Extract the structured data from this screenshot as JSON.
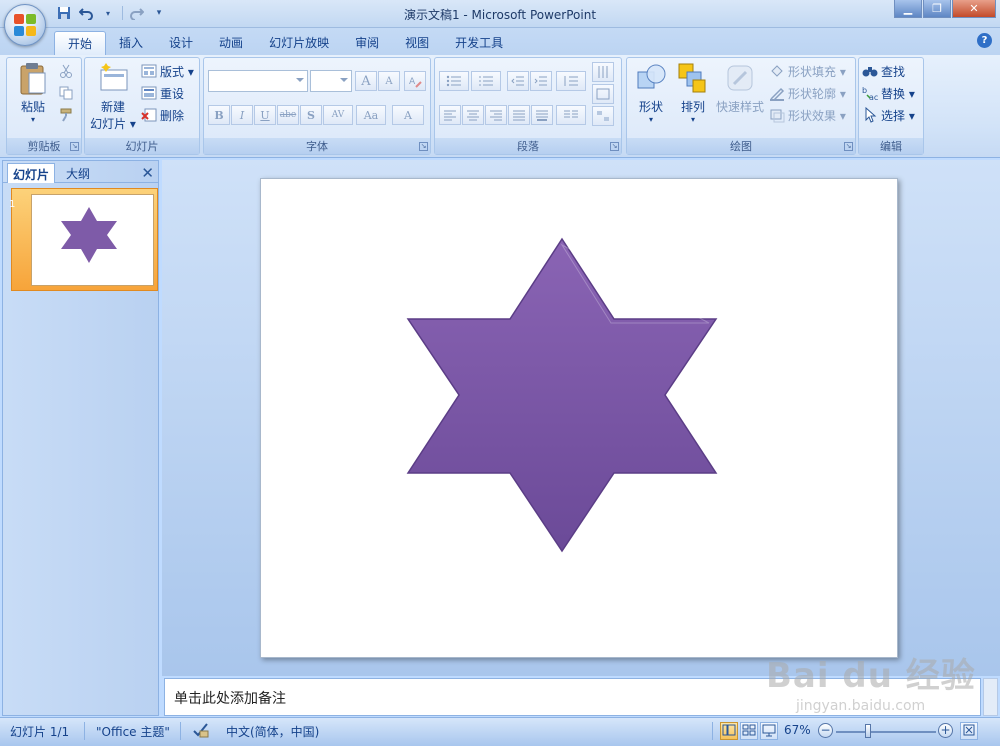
{
  "window": {
    "title": "演示文稿1 - Microsoft PowerPoint",
    "minimize": "▁",
    "maximize": "❐",
    "close": "✕"
  },
  "qat": {
    "save_icon": "save-icon",
    "undo_icon": "undo-icon",
    "redo_icon": "redo-icon",
    "customize_icon": "dropdown-icon"
  },
  "tabs": [
    {
      "label": "开始",
      "active": true
    },
    {
      "label": "插入"
    },
    {
      "label": "设计"
    },
    {
      "label": "动画"
    },
    {
      "label": "幻灯片放映"
    },
    {
      "label": "审阅"
    },
    {
      "label": "视图"
    },
    {
      "label": "开发工具"
    }
  ],
  "help": "?",
  "ribbon": {
    "clipboard": {
      "label": "剪贴板",
      "paste": "粘贴"
    },
    "slides": {
      "label": "幻灯片",
      "new_slide_1": "新建",
      "new_slide_2": "幻灯片 ▾",
      "layout": "版式 ▾",
      "reset": "重设",
      "delete": "删除"
    },
    "font": {
      "label": "字体",
      "bold": "B",
      "italic": "I",
      "underline": "U",
      "strike": "abe",
      "shadow": "S",
      "spacing": "AV",
      "case": "Aa",
      "color": "A",
      "grow": "A",
      "shrink": "A"
    },
    "paragraph": {
      "label": "段落"
    },
    "drawing": {
      "label": "绘图",
      "shapes": "形状",
      "arrange": "排列",
      "quick_styles": "快速样式",
      "fill": "形状填充 ▾",
      "outline": "形状轮廓 ▾",
      "effects": "形状效果 ▾"
    },
    "editing": {
      "label": "编辑",
      "find": "查找",
      "replace": "替换 ▾",
      "select": "选择 ▾"
    }
  },
  "left_panel": {
    "tab_slides": "幻灯片",
    "tab_outline": "大纲",
    "close": "✕",
    "slide_number": "1"
  },
  "slide": {
    "shape": "six-point-star",
    "shape_color": "#7e5ba8"
  },
  "notes": {
    "placeholder": "单击此处添加备注"
  },
  "status": {
    "slide_info": "幻灯片 1/1",
    "theme": "\"Office 主题\"",
    "language": "中文(简体，中国)",
    "zoom": "67%",
    "zoom_out": "−",
    "zoom_in": "+"
  },
  "watermark": {
    "text": "Bai du 经验",
    "url": "jingyan.baidu.com"
  },
  "colors": {
    "accent": "#15428b",
    "star_top": "#8a64b4",
    "star_bottom": "#6b4a98"
  }
}
